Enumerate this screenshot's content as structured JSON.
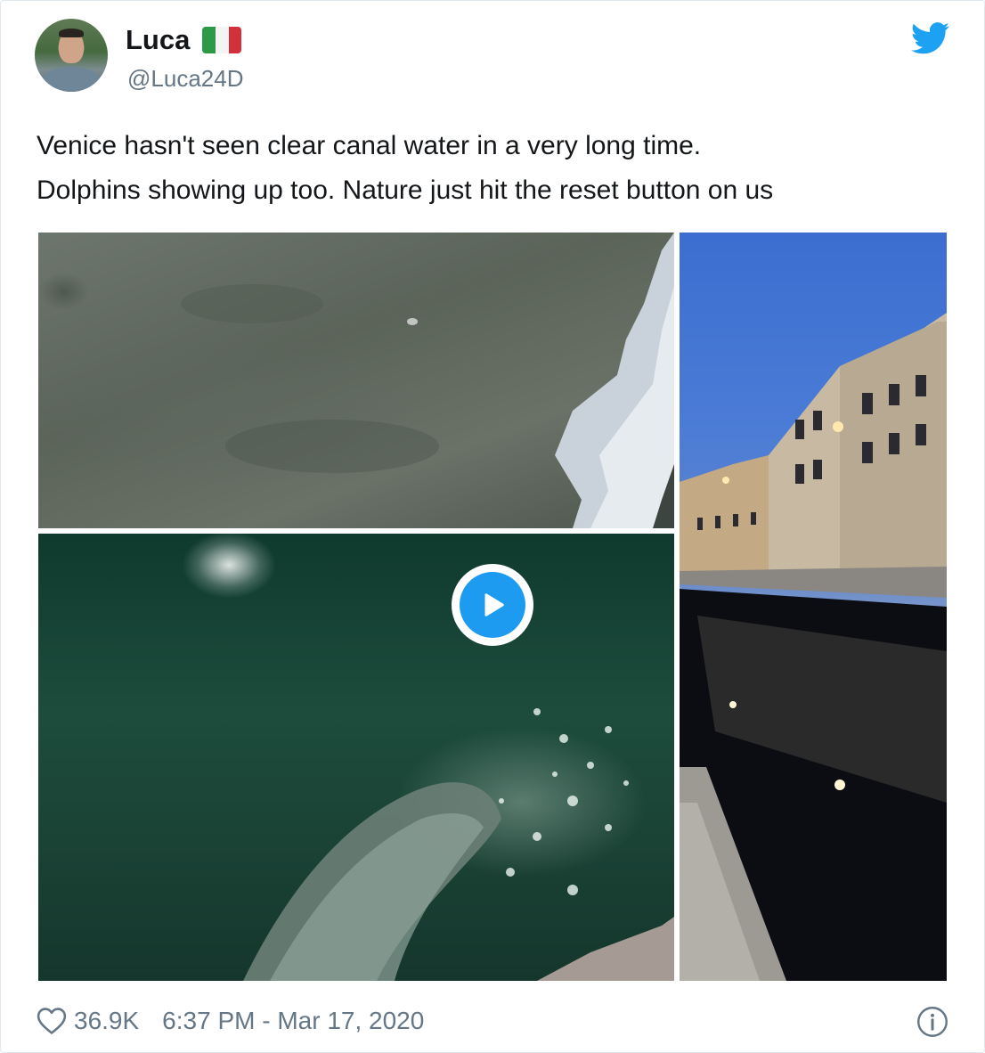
{
  "author": {
    "display_name": "Luca",
    "flag_icon": "italy-flag-icon",
    "handle": "@Luca24D",
    "avatar_icon": "user-avatar"
  },
  "brand": {
    "logo_icon": "twitter-bird-icon",
    "color": "#1da1f2"
  },
  "tweet": {
    "text_lines": [
      "Venice hasn't seen clear canal water in a very long time.",
      "Dolphins showing up too. Nature just hit the reset button on us"
    ]
  },
  "media": {
    "play_icon": "play-icon",
    "accent": "#1d9bf0"
  },
  "footer": {
    "like_icon": "heart-outline-icon",
    "like_count": "36.9K",
    "timestamp": "6:37 PM - Mar 17, 2020",
    "info_icon": "info-icon"
  }
}
